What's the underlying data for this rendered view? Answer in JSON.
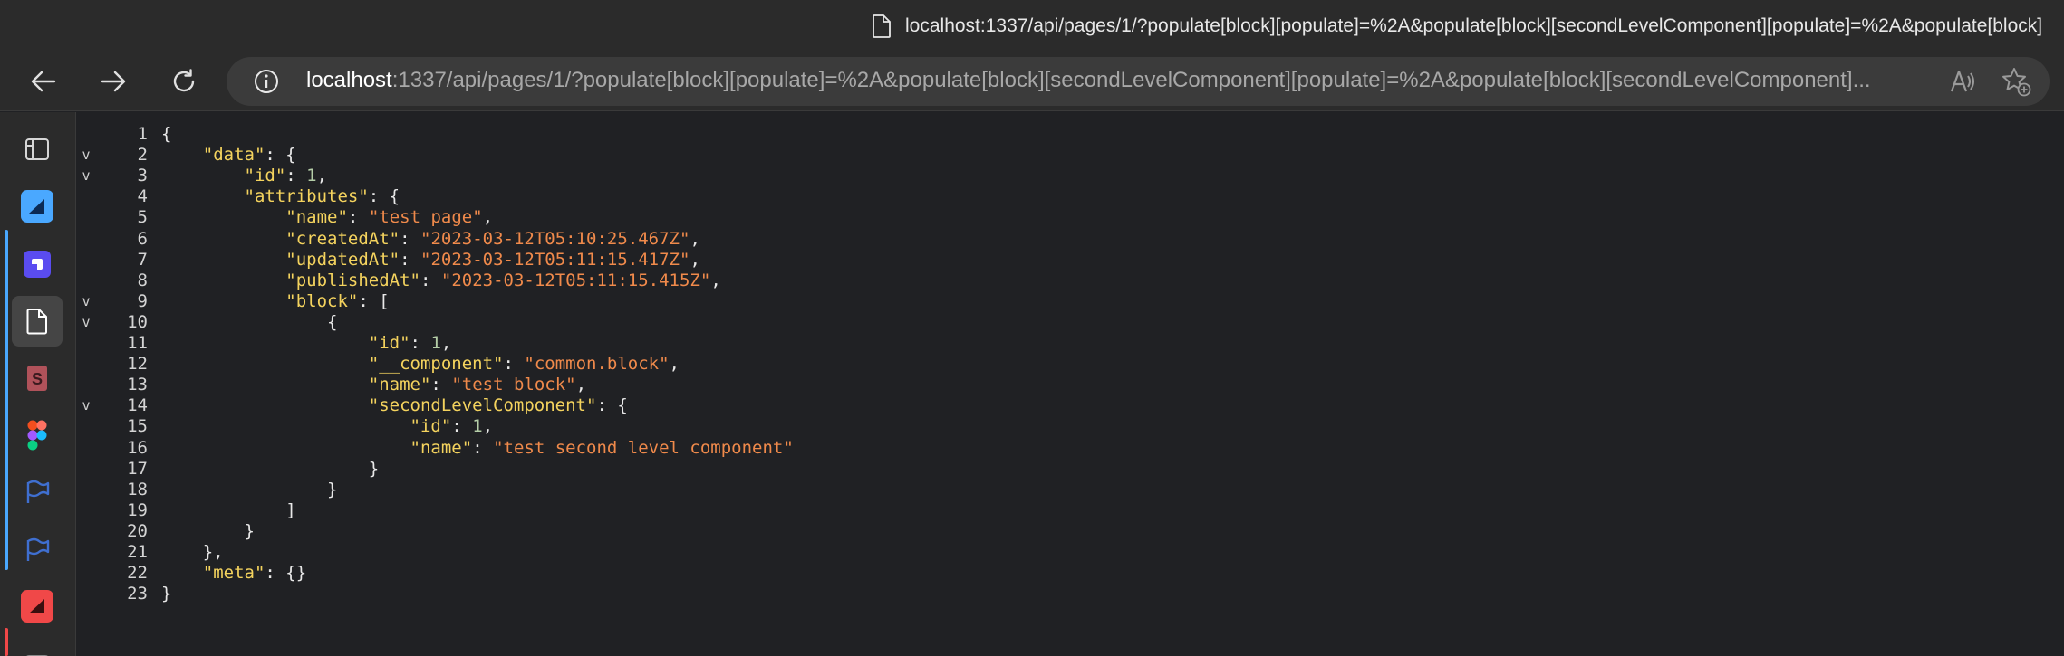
{
  "window": {
    "title": "localhost:1337/api/pages/1/?populate[block][populate]=%2A&populate[block][secondLevelComponent][populate]=%2A&populate[block]"
  },
  "toolbar": {
    "url_host": "localhost",
    "url_rest": ":1337/api/pages/1/?populate[block][populate]=%2A&populate[block][secondLevelComponent][populate]=%2A&populate[block][secondLevelComponent]..."
  },
  "sidebar": {
    "items": [
      {
        "icon": "tab-actions-icon",
        "color": "#d6d6d6"
      },
      {
        "icon": "app-icon-blue",
        "color": "#4aa8ff"
      },
      {
        "icon": "app-icon-purple",
        "color": "#5a4cf0"
      },
      {
        "icon": "document-icon",
        "color": "#ffffff"
      },
      {
        "icon": "s-app-icon",
        "color": "#b0525a"
      },
      {
        "icon": "figma-icon",
        "color": "#a259ff"
      },
      {
        "icon": "flag-icon",
        "color": "#3f6fd0"
      },
      {
        "icon": "flag-icon",
        "color": "#3f6fd0"
      },
      {
        "icon": "app-icon-red",
        "color": "#f04848"
      }
    ]
  },
  "code": {
    "lines": [
      {
        "n": "1",
        "fold": "",
        "t": [
          [
            "p",
            "{"
          ]
        ]
      },
      {
        "n": "2",
        "fold": "v",
        "t": [
          [
            "p",
            "    "
          ],
          [
            "k",
            "\"data\""
          ],
          [
            "p",
            ": {"
          ]
        ]
      },
      {
        "n": "3",
        "fold": "v",
        "t": [
          [
            "p",
            "        "
          ],
          [
            "k",
            "\"id\""
          ],
          [
            "p",
            ": "
          ],
          [
            "n",
            "1"
          ],
          [
            "p",
            ","
          ]
        ]
      },
      {
        "n": "4",
        "fold": "",
        "t": [
          [
            "p",
            "        "
          ],
          [
            "k",
            "\"attributes\""
          ],
          [
            "p",
            ": {"
          ]
        ]
      },
      {
        "n": "5",
        "fold": "",
        "t": [
          [
            "p",
            "            "
          ],
          [
            "k",
            "\"name\""
          ],
          [
            "p",
            ": "
          ],
          [
            "s",
            "\"test page\""
          ],
          [
            "p",
            ","
          ]
        ]
      },
      {
        "n": "6",
        "fold": "",
        "t": [
          [
            "p",
            "            "
          ],
          [
            "k",
            "\"createdAt\""
          ],
          [
            "p",
            ": "
          ],
          [
            "s",
            "\"2023-03-12T05:10:25.467Z\""
          ],
          [
            "p",
            ","
          ]
        ]
      },
      {
        "n": "7",
        "fold": "",
        "t": [
          [
            "p",
            "            "
          ],
          [
            "k",
            "\"updatedAt\""
          ],
          [
            "p",
            ": "
          ],
          [
            "s",
            "\"2023-03-12T05:11:15.417Z\""
          ],
          [
            "p",
            ","
          ]
        ]
      },
      {
        "n": "8",
        "fold": "",
        "t": [
          [
            "p",
            "            "
          ],
          [
            "k",
            "\"publishedAt\""
          ],
          [
            "p",
            ": "
          ],
          [
            "s",
            "\"2023-03-12T05:11:15.415Z\""
          ],
          [
            "p",
            ","
          ]
        ]
      },
      {
        "n": "9",
        "fold": "v",
        "t": [
          [
            "p",
            "            "
          ],
          [
            "k",
            "\"block\""
          ],
          [
            "p",
            ": ["
          ]
        ]
      },
      {
        "n": "10",
        "fold": "v",
        "t": [
          [
            "p",
            "                {"
          ]
        ]
      },
      {
        "n": "11",
        "fold": "",
        "t": [
          [
            "p",
            "                    "
          ],
          [
            "k",
            "\"id\""
          ],
          [
            "p",
            ": "
          ],
          [
            "n",
            "1"
          ],
          [
            "p",
            ","
          ]
        ]
      },
      {
        "n": "12",
        "fold": "",
        "t": [
          [
            "p",
            "                    "
          ],
          [
            "k",
            "\"__component\""
          ],
          [
            "p",
            ": "
          ],
          [
            "s",
            "\"common.block\""
          ],
          [
            "p",
            ","
          ]
        ]
      },
      {
        "n": "13",
        "fold": "",
        "t": [
          [
            "p",
            "                    "
          ],
          [
            "k",
            "\"name\""
          ],
          [
            "p",
            ": "
          ],
          [
            "s",
            "\"test block\""
          ],
          [
            "p",
            ","
          ]
        ]
      },
      {
        "n": "14",
        "fold": "v",
        "t": [
          [
            "p",
            "                    "
          ],
          [
            "k",
            "\"secondLevelComponent\""
          ],
          [
            "p",
            ": {"
          ]
        ]
      },
      {
        "n": "15",
        "fold": "",
        "t": [
          [
            "p",
            "                        "
          ],
          [
            "k",
            "\"id\""
          ],
          [
            "p",
            ": "
          ],
          [
            "n",
            "1"
          ],
          [
            "p",
            ","
          ]
        ]
      },
      {
        "n": "16",
        "fold": "",
        "t": [
          [
            "p",
            "                        "
          ],
          [
            "k",
            "\"name\""
          ],
          [
            "p",
            ": "
          ],
          [
            "s",
            "\"test second level component\""
          ]
        ]
      },
      {
        "n": "17",
        "fold": "",
        "t": [
          [
            "p",
            "                    }"
          ]
        ]
      },
      {
        "n": "18",
        "fold": "",
        "t": [
          [
            "p",
            "                }"
          ]
        ]
      },
      {
        "n": "19",
        "fold": "",
        "t": [
          [
            "p",
            "            ]"
          ]
        ]
      },
      {
        "n": "20",
        "fold": "",
        "t": [
          [
            "p",
            "        }"
          ]
        ]
      },
      {
        "n": "21",
        "fold": "",
        "t": [
          [
            "p",
            "    },"
          ]
        ]
      },
      {
        "n": "22",
        "fold": "",
        "t": [
          [
            "p",
            "    "
          ],
          [
            "k",
            "\"meta\""
          ],
          [
            "p",
            ": {}"
          ]
        ]
      },
      {
        "n": "23",
        "fold": "",
        "t": [
          [
            "p",
            "}"
          ]
        ]
      }
    ]
  }
}
